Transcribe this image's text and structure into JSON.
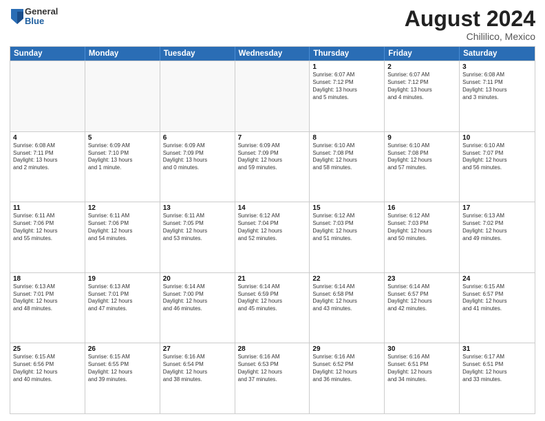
{
  "header": {
    "logo": {
      "general": "General",
      "blue": "Blue"
    },
    "title": "August 2024",
    "location": "Chililico, Mexico"
  },
  "calendar": {
    "days_of_week": [
      "Sunday",
      "Monday",
      "Tuesday",
      "Wednesday",
      "Thursday",
      "Friday",
      "Saturday"
    ],
    "rows": [
      [
        {
          "day": "",
          "info": "",
          "empty": true
        },
        {
          "day": "",
          "info": "",
          "empty": true
        },
        {
          "day": "",
          "info": "",
          "empty": true
        },
        {
          "day": "",
          "info": "",
          "empty": true
        },
        {
          "day": "1",
          "info": "Sunrise: 6:07 AM\nSunset: 7:12 PM\nDaylight: 13 hours\nand 5 minutes.",
          "empty": false
        },
        {
          "day": "2",
          "info": "Sunrise: 6:07 AM\nSunset: 7:12 PM\nDaylight: 13 hours\nand 4 minutes.",
          "empty": false
        },
        {
          "day": "3",
          "info": "Sunrise: 6:08 AM\nSunset: 7:11 PM\nDaylight: 13 hours\nand 3 minutes.",
          "empty": false
        }
      ],
      [
        {
          "day": "4",
          "info": "Sunrise: 6:08 AM\nSunset: 7:11 PM\nDaylight: 13 hours\nand 2 minutes.",
          "empty": false
        },
        {
          "day": "5",
          "info": "Sunrise: 6:09 AM\nSunset: 7:10 PM\nDaylight: 13 hours\nand 1 minute.",
          "empty": false
        },
        {
          "day": "6",
          "info": "Sunrise: 6:09 AM\nSunset: 7:09 PM\nDaylight: 13 hours\nand 0 minutes.",
          "empty": false
        },
        {
          "day": "7",
          "info": "Sunrise: 6:09 AM\nSunset: 7:09 PM\nDaylight: 12 hours\nand 59 minutes.",
          "empty": false
        },
        {
          "day": "8",
          "info": "Sunrise: 6:10 AM\nSunset: 7:08 PM\nDaylight: 12 hours\nand 58 minutes.",
          "empty": false
        },
        {
          "day": "9",
          "info": "Sunrise: 6:10 AM\nSunset: 7:08 PM\nDaylight: 12 hours\nand 57 minutes.",
          "empty": false
        },
        {
          "day": "10",
          "info": "Sunrise: 6:10 AM\nSunset: 7:07 PM\nDaylight: 12 hours\nand 56 minutes.",
          "empty": false
        }
      ],
      [
        {
          "day": "11",
          "info": "Sunrise: 6:11 AM\nSunset: 7:06 PM\nDaylight: 12 hours\nand 55 minutes.",
          "empty": false
        },
        {
          "day": "12",
          "info": "Sunrise: 6:11 AM\nSunset: 7:06 PM\nDaylight: 12 hours\nand 54 minutes.",
          "empty": false
        },
        {
          "day": "13",
          "info": "Sunrise: 6:11 AM\nSunset: 7:05 PM\nDaylight: 12 hours\nand 53 minutes.",
          "empty": false
        },
        {
          "day": "14",
          "info": "Sunrise: 6:12 AM\nSunset: 7:04 PM\nDaylight: 12 hours\nand 52 minutes.",
          "empty": false
        },
        {
          "day": "15",
          "info": "Sunrise: 6:12 AM\nSunset: 7:03 PM\nDaylight: 12 hours\nand 51 minutes.",
          "empty": false
        },
        {
          "day": "16",
          "info": "Sunrise: 6:12 AM\nSunset: 7:03 PM\nDaylight: 12 hours\nand 50 minutes.",
          "empty": false
        },
        {
          "day": "17",
          "info": "Sunrise: 6:13 AM\nSunset: 7:02 PM\nDaylight: 12 hours\nand 49 minutes.",
          "empty": false
        }
      ],
      [
        {
          "day": "18",
          "info": "Sunrise: 6:13 AM\nSunset: 7:01 PM\nDaylight: 12 hours\nand 48 minutes.",
          "empty": false
        },
        {
          "day": "19",
          "info": "Sunrise: 6:13 AM\nSunset: 7:01 PM\nDaylight: 12 hours\nand 47 minutes.",
          "empty": false
        },
        {
          "day": "20",
          "info": "Sunrise: 6:14 AM\nSunset: 7:00 PM\nDaylight: 12 hours\nand 46 minutes.",
          "empty": false
        },
        {
          "day": "21",
          "info": "Sunrise: 6:14 AM\nSunset: 6:59 PM\nDaylight: 12 hours\nand 45 minutes.",
          "empty": false
        },
        {
          "day": "22",
          "info": "Sunrise: 6:14 AM\nSunset: 6:58 PM\nDaylight: 12 hours\nand 43 minutes.",
          "empty": false
        },
        {
          "day": "23",
          "info": "Sunrise: 6:14 AM\nSunset: 6:57 PM\nDaylight: 12 hours\nand 42 minutes.",
          "empty": false
        },
        {
          "day": "24",
          "info": "Sunrise: 6:15 AM\nSunset: 6:57 PM\nDaylight: 12 hours\nand 41 minutes.",
          "empty": false
        }
      ],
      [
        {
          "day": "25",
          "info": "Sunrise: 6:15 AM\nSunset: 6:56 PM\nDaylight: 12 hours\nand 40 minutes.",
          "empty": false
        },
        {
          "day": "26",
          "info": "Sunrise: 6:15 AM\nSunset: 6:55 PM\nDaylight: 12 hours\nand 39 minutes.",
          "empty": false
        },
        {
          "day": "27",
          "info": "Sunrise: 6:16 AM\nSunset: 6:54 PM\nDaylight: 12 hours\nand 38 minutes.",
          "empty": false
        },
        {
          "day": "28",
          "info": "Sunrise: 6:16 AM\nSunset: 6:53 PM\nDaylight: 12 hours\nand 37 minutes.",
          "empty": false
        },
        {
          "day": "29",
          "info": "Sunrise: 6:16 AM\nSunset: 6:52 PM\nDaylight: 12 hours\nand 36 minutes.",
          "empty": false
        },
        {
          "day": "30",
          "info": "Sunrise: 6:16 AM\nSunset: 6:51 PM\nDaylight: 12 hours\nand 34 minutes.",
          "empty": false
        },
        {
          "day": "31",
          "info": "Sunrise: 6:17 AM\nSunset: 6:51 PM\nDaylight: 12 hours\nand 33 minutes.",
          "empty": false
        }
      ]
    ]
  }
}
